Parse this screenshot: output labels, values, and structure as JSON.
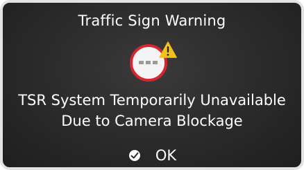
{
  "dialog": {
    "title": "Traffic Sign Warning",
    "sign_icon": "no-sign-with-warning-icon",
    "message_line1": "TSR System Temporarily Unavailable",
    "message_line2": "Due to Camera Blockage",
    "ok_icon": "check-circle-icon",
    "ok_label": "OK"
  },
  "colors": {
    "background": "#2a2a2a",
    "text": "#ffffff",
    "sign_border": "#d7262f",
    "warning": "#f2c21b"
  }
}
